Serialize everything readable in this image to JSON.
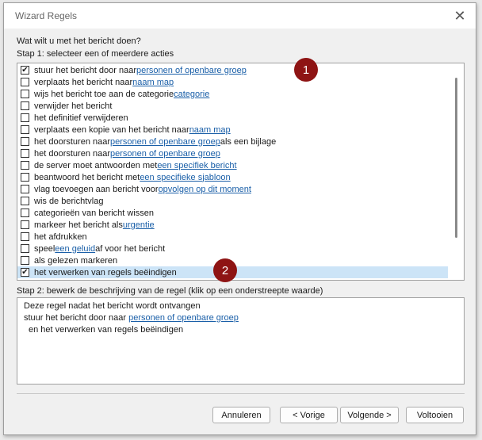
{
  "window": {
    "title": "Wizard Regels",
    "close_glyph": "✕"
  },
  "question": "Wat wilt u met het bericht doen?",
  "step1_label": "Stap 1: selecteer een of meerdere acties",
  "actions": [
    {
      "checked": true,
      "text": "stuur het bericht door naar ",
      "link": "personen of openbare groep",
      "suffix": ""
    },
    {
      "checked": false,
      "text": "verplaats het bericht naar ",
      "link": "naam map",
      "suffix": ""
    },
    {
      "checked": false,
      "text": "wijs het bericht toe aan de categorie ",
      "link": "categorie",
      "suffix": ""
    },
    {
      "checked": false,
      "text": "verwijder het bericht",
      "link": "",
      "suffix": ""
    },
    {
      "checked": false,
      "text": "het definitief verwijderen",
      "link": "",
      "suffix": ""
    },
    {
      "checked": false,
      "text": "verplaats een kopie van het bericht naar ",
      "link": "naam map",
      "suffix": ""
    },
    {
      "checked": false,
      "text": "het doorsturen naar ",
      "link": "personen of openbare groep",
      "suffix": " als een bijlage"
    },
    {
      "checked": false,
      "text": "het doorsturen naar ",
      "link": "personen of openbare groep",
      "suffix": ""
    },
    {
      "checked": false,
      "text": "de server moet antwoorden met ",
      "link": "een specifiek bericht",
      "suffix": ""
    },
    {
      "checked": false,
      "text": "beantwoord het bericht met ",
      "link": "een specifieke sjabloon",
      "suffix": ""
    },
    {
      "checked": false,
      "text": "vlag toevoegen aan bericht voor ",
      "link": "opvolgen op dit moment",
      "suffix": ""
    },
    {
      "checked": false,
      "text": "wis de berichtvlag",
      "link": "",
      "suffix": ""
    },
    {
      "checked": false,
      "text": "categorieën van bericht wissen",
      "link": "",
      "suffix": ""
    },
    {
      "checked": false,
      "text": "markeer het bericht als ",
      "link": "urgentie",
      "suffix": ""
    },
    {
      "checked": false,
      "text": "het afdrukken",
      "link": "",
      "suffix": ""
    },
    {
      "checked": false,
      "text": "speel ",
      "link": "een geluid",
      "suffix": " af voor het bericht"
    },
    {
      "checked": false,
      "text": "als gelezen markeren",
      "link": "",
      "suffix": ""
    },
    {
      "checked": true,
      "text": "het verwerken van regels beëindigen",
      "link": "",
      "suffix": "",
      "selected": true
    }
  ],
  "step2_label": "Stap 2: bewerk de beschrijving van de regel (klik op een onderstreepte waarde)",
  "description": {
    "line1": "Deze regel nadat het bericht wordt ontvangen",
    "line2_text": "stuur het bericht door naar ",
    "line2_link": "personen of openbare groep",
    "line3": "en het verwerken van regels beëindigen"
  },
  "badges": {
    "one": "1",
    "two": "2"
  },
  "buttons": {
    "cancel": "Annuleren",
    "back": "< Vorige",
    "next": "Volgende >",
    "finish": "Voltooien"
  },
  "check_glyph": "✔",
  "colors": {
    "link": "#1a5fa8",
    "selection": "#cce4f7",
    "badge": "#8e1414"
  }
}
